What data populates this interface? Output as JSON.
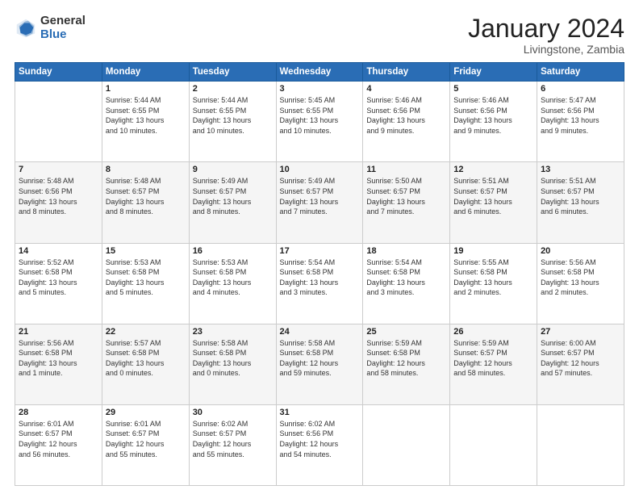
{
  "logo": {
    "general": "General",
    "blue": "Blue"
  },
  "title": "January 2024",
  "location": "Livingstone, Zambia",
  "days_header": [
    "Sunday",
    "Monday",
    "Tuesday",
    "Wednesday",
    "Thursday",
    "Friday",
    "Saturday"
  ],
  "weeks": [
    [
      {
        "day": "",
        "info": ""
      },
      {
        "day": "1",
        "info": "Sunrise: 5:44 AM\nSunset: 6:55 PM\nDaylight: 13 hours\nand 10 minutes."
      },
      {
        "day": "2",
        "info": "Sunrise: 5:44 AM\nSunset: 6:55 PM\nDaylight: 13 hours\nand 10 minutes."
      },
      {
        "day": "3",
        "info": "Sunrise: 5:45 AM\nSunset: 6:55 PM\nDaylight: 13 hours\nand 10 minutes."
      },
      {
        "day": "4",
        "info": "Sunrise: 5:46 AM\nSunset: 6:56 PM\nDaylight: 13 hours\nand 9 minutes."
      },
      {
        "day": "5",
        "info": "Sunrise: 5:46 AM\nSunset: 6:56 PM\nDaylight: 13 hours\nand 9 minutes."
      },
      {
        "day": "6",
        "info": "Sunrise: 5:47 AM\nSunset: 6:56 PM\nDaylight: 13 hours\nand 9 minutes."
      }
    ],
    [
      {
        "day": "7",
        "info": "Sunrise: 5:48 AM\nSunset: 6:56 PM\nDaylight: 13 hours\nand 8 minutes."
      },
      {
        "day": "8",
        "info": "Sunrise: 5:48 AM\nSunset: 6:57 PM\nDaylight: 13 hours\nand 8 minutes."
      },
      {
        "day": "9",
        "info": "Sunrise: 5:49 AM\nSunset: 6:57 PM\nDaylight: 13 hours\nand 8 minutes."
      },
      {
        "day": "10",
        "info": "Sunrise: 5:49 AM\nSunset: 6:57 PM\nDaylight: 13 hours\nand 7 minutes."
      },
      {
        "day": "11",
        "info": "Sunrise: 5:50 AM\nSunset: 6:57 PM\nDaylight: 13 hours\nand 7 minutes."
      },
      {
        "day": "12",
        "info": "Sunrise: 5:51 AM\nSunset: 6:57 PM\nDaylight: 13 hours\nand 6 minutes."
      },
      {
        "day": "13",
        "info": "Sunrise: 5:51 AM\nSunset: 6:57 PM\nDaylight: 13 hours\nand 6 minutes."
      }
    ],
    [
      {
        "day": "14",
        "info": "Sunrise: 5:52 AM\nSunset: 6:58 PM\nDaylight: 13 hours\nand 5 minutes."
      },
      {
        "day": "15",
        "info": "Sunrise: 5:53 AM\nSunset: 6:58 PM\nDaylight: 13 hours\nand 5 minutes."
      },
      {
        "day": "16",
        "info": "Sunrise: 5:53 AM\nSunset: 6:58 PM\nDaylight: 13 hours\nand 4 minutes."
      },
      {
        "day": "17",
        "info": "Sunrise: 5:54 AM\nSunset: 6:58 PM\nDaylight: 13 hours\nand 3 minutes."
      },
      {
        "day": "18",
        "info": "Sunrise: 5:54 AM\nSunset: 6:58 PM\nDaylight: 13 hours\nand 3 minutes."
      },
      {
        "day": "19",
        "info": "Sunrise: 5:55 AM\nSunset: 6:58 PM\nDaylight: 13 hours\nand 2 minutes."
      },
      {
        "day": "20",
        "info": "Sunrise: 5:56 AM\nSunset: 6:58 PM\nDaylight: 13 hours\nand 2 minutes."
      }
    ],
    [
      {
        "day": "21",
        "info": "Sunrise: 5:56 AM\nSunset: 6:58 PM\nDaylight: 13 hours\nand 1 minute."
      },
      {
        "day": "22",
        "info": "Sunrise: 5:57 AM\nSunset: 6:58 PM\nDaylight: 13 hours\nand 0 minutes."
      },
      {
        "day": "23",
        "info": "Sunrise: 5:58 AM\nSunset: 6:58 PM\nDaylight: 13 hours\nand 0 minutes."
      },
      {
        "day": "24",
        "info": "Sunrise: 5:58 AM\nSunset: 6:58 PM\nDaylight: 12 hours\nand 59 minutes."
      },
      {
        "day": "25",
        "info": "Sunrise: 5:59 AM\nSunset: 6:58 PM\nDaylight: 12 hours\nand 58 minutes."
      },
      {
        "day": "26",
        "info": "Sunrise: 5:59 AM\nSunset: 6:57 PM\nDaylight: 12 hours\nand 58 minutes."
      },
      {
        "day": "27",
        "info": "Sunrise: 6:00 AM\nSunset: 6:57 PM\nDaylight: 12 hours\nand 57 minutes."
      }
    ],
    [
      {
        "day": "28",
        "info": "Sunrise: 6:01 AM\nSunset: 6:57 PM\nDaylight: 12 hours\nand 56 minutes."
      },
      {
        "day": "29",
        "info": "Sunrise: 6:01 AM\nSunset: 6:57 PM\nDaylight: 12 hours\nand 55 minutes."
      },
      {
        "day": "30",
        "info": "Sunrise: 6:02 AM\nSunset: 6:57 PM\nDaylight: 12 hours\nand 55 minutes."
      },
      {
        "day": "31",
        "info": "Sunrise: 6:02 AM\nSunset: 6:56 PM\nDaylight: 12 hours\nand 54 minutes."
      },
      {
        "day": "",
        "info": ""
      },
      {
        "day": "",
        "info": ""
      },
      {
        "day": "",
        "info": ""
      }
    ]
  ]
}
